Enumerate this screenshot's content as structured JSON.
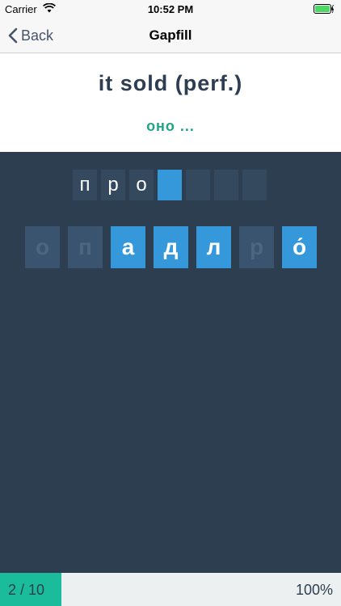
{
  "status_bar": {
    "carrier": "Carrier",
    "time": "10:52 PM",
    "battery_color": "#4cd964"
  },
  "nav": {
    "back_label": "Back",
    "title": "Gapfill"
  },
  "prompt": {
    "text": "it sold (perf.)",
    "hint": "оно ..."
  },
  "answer_slots": [
    "п",
    "р",
    "о",
    "",
    "",
    "",
    ""
  ],
  "active_slot_index": 3,
  "letter_tiles": [
    {
      "char": "о",
      "available": false
    },
    {
      "char": "п",
      "available": false
    },
    {
      "char": "а",
      "available": true
    },
    {
      "char": "д",
      "available": true
    },
    {
      "char": "л",
      "available": true
    },
    {
      "char": "р",
      "available": false
    },
    {
      "char": "о́",
      "available": true
    }
  ],
  "footer": {
    "counter": "2 / 10",
    "percent": "100%",
    "progress_fraction": 0.18
  },
  "colors": {
    "background": "#2d3e50",
    "accent_blue": "#3498db",
    "accent_green": "#1abc9c",
    "hint_green": "#1fa38a"
  },
  "icons": [
    "wifi-icon",
    "battery-icon",
    "chevron-left-icon"
  ]
}
